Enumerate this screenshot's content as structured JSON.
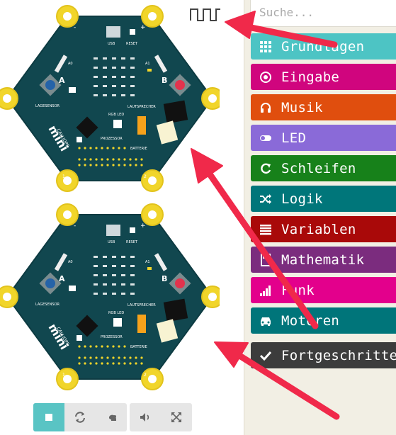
{
  "simulator": {
    "boards": [
      {
        "brand_line1": "CALLIOPE",
        "brand_line2": "mini",
        "labels": {
          "usb": "USB",
          "reset": "RESET",
          "a0": "A0",
          "a1": "A1",
          "button_a": "A",
          "button_b": "B",
          "plus": "+",
          "minus": "-",
          "lagesensor": "LAGESENSOR",
          "lautsprecher": "LAUTSPRECHER",
          "rgb_led": "RGB LED",
          "prozessor": "PROZESSOR",
          "batterie": "BATTERIE",
          "pin0": "0",
          "pin1": "1",
          "pin2": "2",
          "pin3": "3"
        }
      },
      {
        "brand_line1": "CALLIOPE",
        "brand_line2": "mini",
        "labels": {
          "usb": "USB",
          "reset": "RESET",
          "a0": "A0",
          "a1": "A1",
          "button_a": "A",
          "button_b": "B",
          "plus": "+",
          "minus": "-",
          "lagesensor": "LAGESENSOR",
          "lautsprecher": "LAUTSPRECHER",
          "rgb_led": "RGB LED",
          "prozessor": "PROZESSOR",
          "batterie": "BATTERIE",
          "pin0": "0",
          "pin1": "1",
          "pin2": "2",
          "pin3": "3"
        }
      }
    ],
    "toolbar": {
      "buttons": [
        {
          "icon": "stop-icon",
          "active": true
        },
        {
          "icon": "restart-icon",
          "active": false
        },
        {
          "icon": "slow-motion-icon",
          "active": false
        },
        {
          "icon": "mute-icon",
          "active": false
        },
        {
          "icon": "fullscreen-icon",
          "active": false
        }
      ]
    },
    "waveform_icon": "square-wave-icon"
  },
  "toolbox": {
    "search": {
      "value": "",
      "placeholder": "Suche..."
    },
    "categories": [
      {
        "label": "Grundlagen",
        "icon": "grid-icon",
        "color": "#1e90ff"
      },
      {
        "label": "Eingabe",
        "icon": "radio-icon",
        "color": "#d400d4"
      },
      {
        "label": "Musik",
        "icon": "headphones-icon",
        "color": "#e63022"
      },
      {
        "label": "LED",
        "icon": "toggle-icon",
        "color": "#5c2d91"
      },
      {
        "label": "Schleifen",
        "icon": "refresh-icon",
        "color": "#00aa00"
      },
      {
        "label": "Logik",
        "icon": "shuffle-icon",
        "color": "#00a4a6"
      },
      {
        "label": "Variablen",
        "icon": "list-icon",
        "color": "#dc143c"
      },
      {
        "label": "Mathematik",
        "icon": "calculator-icon",
        "color": "#9400d3"
      },
      {
        "label": "Funk",
        "icon": "signal-icon",
        "color": "#e3008c"
      },
      {
        "label": "Motoren",
        "icon": "car-icon",
        "color": "#00a4a6"
      },
      {
        "label": "Fortgeschritten",
        "icon": "chevron-icon",
        "color": "#3c3c3c"
      }
    ],
    "category_colors_rendered": [
      "#4dc4c4",
      "#d0057e",
      "#e04e0e",
      "#8a6ad8",
      "#17811a",
      "#00767a",
      "#a90909",
      "#7b2c7e",
      "#e3008c",
      "#00757a",
      "#3c3c3c"
    ]
  },
  "annotations": {
    "arrow_color": "#f0294a"
  }
}
